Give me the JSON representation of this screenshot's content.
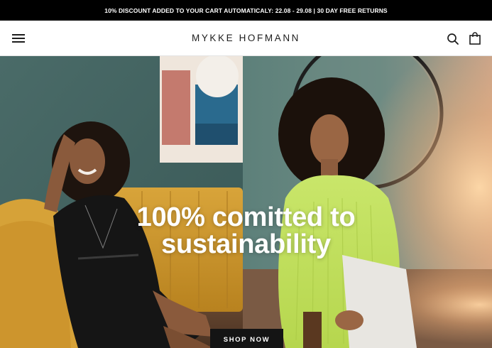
{
  "announcement": {
    "text": "10% DISCOUNT ADDED TO YOUR CART AUTOMATICALY: 22.08 - 29.08 | 30 DAY FREE RETURNS"
  },
  "header": {
    "logo": "MYKKE HOFMANN",
    "menu_icon": "hamburger-menu-icon",
    "search_icon": "search-icon",
    "cart_icon": "shopping-bag-icon"
  },
  "hero": {
    "headline_line1": "100% comitted to",
    "headline_line2": "sustainability",
    "cta_label": "SHOP NOW",
    "left_image": "woman-in-black-dress-on-yellow-sofa",
    "right_image": "woman-in-lime-green-sweater"
  },
  "colors": {
    "announcement_bg": "#000000",
    "header_bg": "#ffffff",
    "cta_bg": "#141414",
    "headline": "#ffffff"
  }
}
